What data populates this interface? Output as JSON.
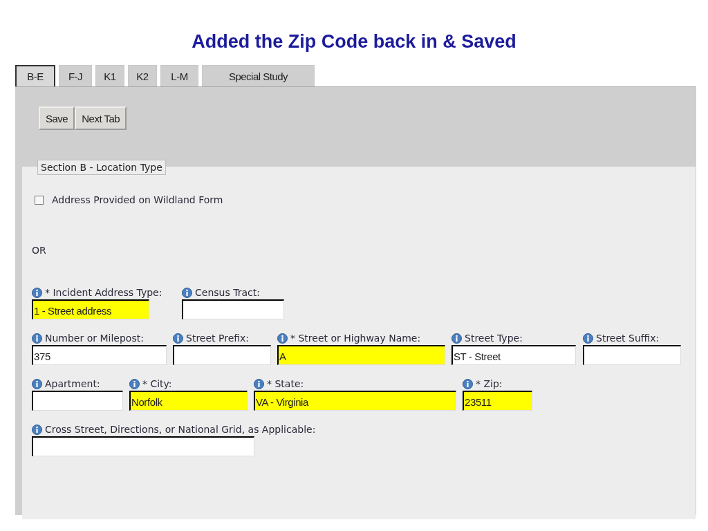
{
  "slide_title": "Added the Zip Code back in & Saved",
  "tabs": [
    {
      "label": "B-E",
      "selected": true
    },
    {
      "label": "F-J",
      "selected": false
    },
    {
      "label": "K1",
      "selected": false
    },
    {
      "label": "K2",
      "selected": false
    },
    {
      "label": "L-M",
      "selected": false
    },
    {
      "label": "Special Study",
      "selected": false
    }
  ],
  "buttons": [
    "Save",
    "Next Tab"
  ],
  "section": {
    "legend": "Section B - Location Type",
    "checkbox": {
      "label": "Address Provided on Wildland Form",
      "checked": false
    },
    "or_text": "OR",
    "field_rows": [
      [
        {
          "label": "* Incident Address Type:",
          "value": "1 - Street address",
          "required": true
        },
        {
          "label": "Census Tract:",
          "required": false
        }
      ],
      [
        {
          "label": "Number or Milepost:",
          "value": "375",
          "required": false
        },
        {
          "label": "Street Prefix:",
          "required": false
        },
        {
          "label": "* Street or Highway Name:",
          "value": "A",
          "required": true
        },
        {
          "label": "Street Type:",
          "value": "ST - Street",
          "required": false
        },
        {
          "label": "Street Suffix:",
          "required": false
        }
      ],
      [
        {
          "label": "Apartment:",
          "required": false
        },
        {
          "label": "* City:",
          "value": "Norfolk",
          "required": true
        },
        {
          "label": "* State:",
          "value": "VA - Virginia",
          "required": true
        },
        {
          "label": "* Zip:",
          "value": "23511",
          "required": true
        }
      ],
      [
        {
          "label": "Cross Street, Directions, or National Grid, as Applicable:",
          "required": false
        }
      ]
    ]
  }
}
